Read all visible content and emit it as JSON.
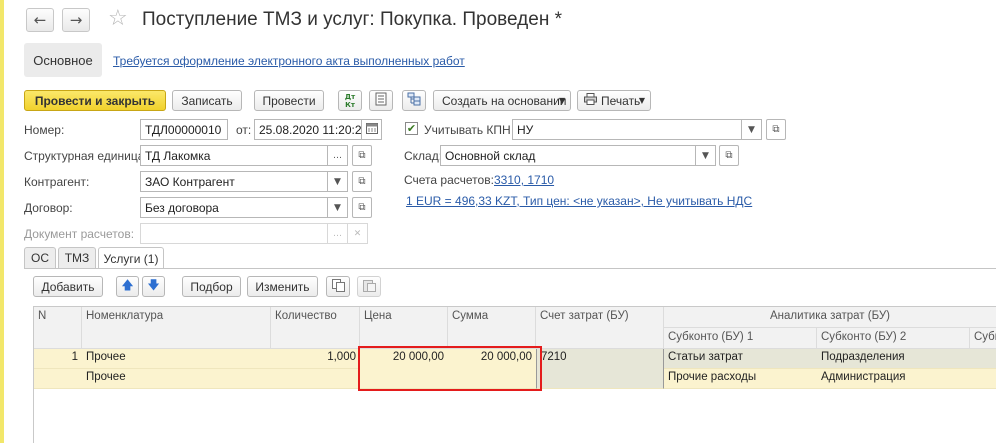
{
  "window": {
    "title": "Поступление ТМЗ и услуг: Покупка. Проведен *",
    "back_icon": "←",
    "forward_icon": "→",
    "favorite_icon": "☆"
  },
  "section_tab": {
    "label": "Основное"
  },
  "notice_link": "Требуется оформление электронного акта выполненных работ",
  "toolbar": {
    "post_close_label": "Провести и закрыть",
    "save_label": "Записать",
    "post_label": "Провести",
    "dtkt_icon": "Дт Кт",
    "create_based_label": "Создать на основании",
    "print_label": "Печать"
  },
  "form": {
    "number_label": "Номер:",
    "number_value": "ТДЛ00000010",
    "date_label": "от:",
    "date_value": "25.08.2020 11:20:22",
    "kpn_label": "Учитывать КПН",
    "kpn_checked": "✔",
    "kpn_value": "НУ",
    "unit_label": "Структурная единица:",
    "unit_value": "ТД Лакомка",
    "warehouse_label": "Склад:",
    "warehouse_value": "Основной склад",
    "counterparty_label": "Контрагент:",
    "counterparty_value": "ЗАО Контрагент",
    "accounts_label": "Счета расчетов:",
    "accounts_link": "3310, 1710",
    "contract_label": "Договор:",
    "contract_value": "Без договора",
    "rate_link": "1 EUR = 496,33 KZT, Тип цен: <не указан>, Не учитывать НДС",
    "settlement_doc_label": "Документ расчетов:",
    "settlement_doc_value": ""
  },
  "tabs": [
    {
      "label": "ОС"
    },
    {
      "label": "ТМЗ"
    },
    {
      "label": "Услуги (1)"
    }
  ],
  "table_toolbar": {
    "add_label": "Добавить",
    "up_icon": "🡅",
    "down_icon": "🡇",
    "pick_label": "Подбор",
    "edit_label": "Изменить"
  },
  "table": {
    "headers": {
      "n": "N",
      "nomenclature": "Номенклатура",
      "quantity": "Количество",
      "price": "Цена",
      "sum": "Сумма",
      "cost_account": "Счет затрат (БУ)",
      "analytics": "Аналитика затрат (БУ)",
      "subkonto1": "Субконто (БУ) 1",
      "subkonto2": "Субконто (БУ) 2",
      "subkonto3": "Субко"
    },
    "rows": [
      {
        "n": "1",
        "nomenclature": "Прочее",
        "nomenclature2": "Прочее",
        "quantity": "1,000",
        "price": "20 000,00",
        "sum": "20 000,00",
        "cost_account": "7210",
        "subkonto1": "Статьи затрат",
        "subkonto1_value": "Прочие расходы",
        "subkonto2": "Подразделения",
        "subkonto2_value": "Администрация"
      }
    ]
  },
  "colors": {
    "primary_button": "#f1d12c",
    "link": "#2a5ba8",
    "row_highlight": "#fbf3cf",
    "highlight_frame": "#e41c1c"
  }
}
